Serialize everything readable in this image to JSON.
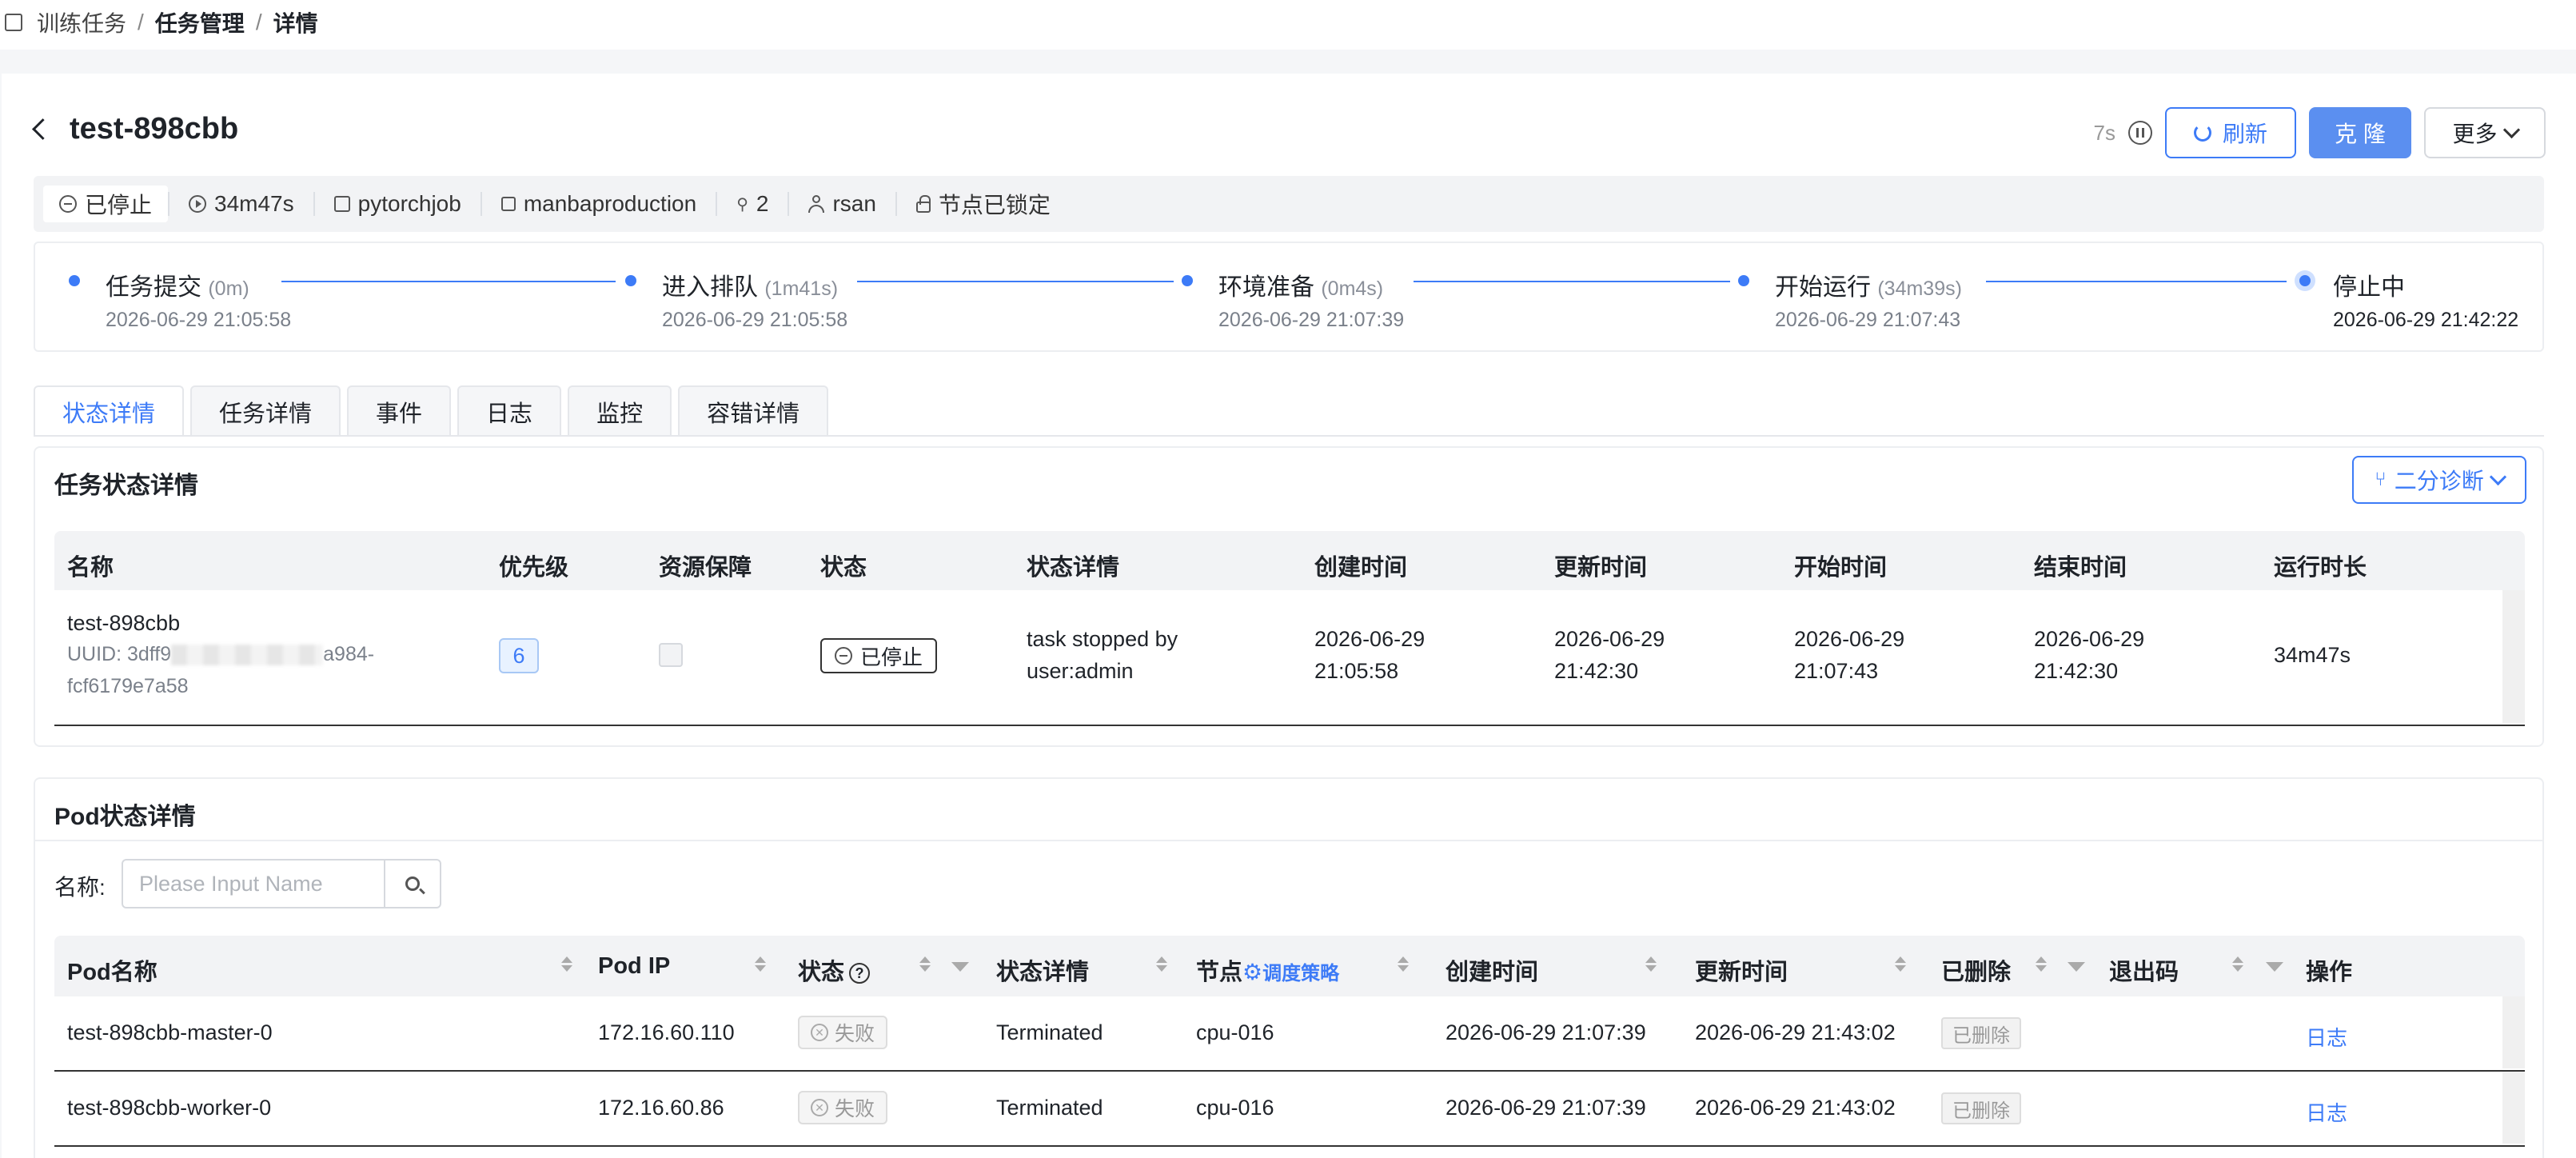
{
  "breadcrumb": {
    "items": [
      "训练任务",
      "任务管理",
      "详情"
    ],
    "separator": "/"
  },
  "header": {
    "title": "test-898cbb",
    "timer": "7s",
    "refresh_label": "刷新",
    "clone_label": "克 隆",
    "more_label": "更多"
  },
  "info": {
    "status": "已停止",
    "duration": "34m47s",
    "framework": "pytorchjob",
    "project": "manbaproduction",
    "nodes": "2",
    "user": "rsan",
    "lock": "节点已锁定"
  },
  "timeline": [
    {
      "label": "任务提交",
      "duration": "(0m)",
      "time": "2026-06-29 21:05:58"
    },
    {
      "label": "进入排队",
      "duration": "(1m41s)",
      "time": "2026-06-29 21:05:58"
    },
    {
      "label": "环境准备",
      "duration": "(0m4s)",
      "time": "2026-06-29 21:07:39"
    },
    {
      "label": "开始运行",
      "duration": "(34m39s)",
      "time": "2026-06-29 21:07:43"
    },
    {
      "label": "停止中",
      "duration": "",
      "time": "2026-06-29 21:42:22"
    }
  ],
  "tabs": [
    "状态详情",
    "任务详情",
    "事件",
    "日志",
    "监控",
    "容错详情"
  ],
  "task_status": {
    "title": "任务状态详情",
    "diagnose_label": "二分诊断",
    "columns": [
      "名称",
      "优先级",
      "资源保障",
      "状态",
      "状态详情",
      "创建时间",
      "更新时间",
      "开始时间",
      "结束时间",
      "运行时长"
    ],
    "row": {
      "name": "test-898cbb",
      "uuid_prefix": "UUID: 3dff9",
      "uuid_mid": "a984-",
      "uuid_suffix": "fcf6179e7a58",
      "priority": "6",
      "status": "已停止",
      "detail_1": "task stopped by",
      "detail_2": "user:admin",
      "created_1": "2026-06-29",
      "created_2": "21:05:58",
      "updated_1": "2026-06-29",
      "updated_2": "21:42:30",
      "started_1": "2026-06-29",
      "started_2": "21:07:43",
      "ended_1": "2026-06-29",
      "ended_2": "21:42:30",
      "runtime": "34m47s"
    }
  },
  "pod_status": {
    "title": "Pod状态详情",
    "search_label": "名称:",
    "search_placeholder": "Please Input Name",
    "columns": {
      "pod_name": "Pod名称",
      "pod_ip": "Pod IP",
      "status": "状态",
      "status_detail": "状态详情",
      "node": "节点",
      "schedule_policy": "调度策略",
      "created": "创建时间",
      "updated": "更新时间",
      "deleted": "已删除",
      "exit_code": "退出码",
      "action": "操作"
    },
    "rows": [
      {
        "name": "test-898cbb-master-0",
        "ip": "172.16.60.110",
        "status": "失败",
        "detail": "Terminated",
        "node": "cpu-016",
        "created": "2026-06-29 21:07:39",
        "updated": "2026-06-29 21:43:02",
        "deleted": "已删除",
        "exit_code": "",
        "action": "日志"
      },
      {
        "name": "test-898cbb-worker-0",
        "ip": "172.16.60.86",
        "status": "失败",
        "detail": "Terminated",
        "node": "cpu-016",
        "created": "2026-06-29 21:07:39",
        "updated": "2026-06-29 21:43:02",
        "deleted": "已删除",
        "exit_code": "",
        "action": "日志"
      }
    ]
  },
  "colors": {
    "primary": "#3d7bf7",
    "primary_fill": "#5b8ff0",
    "page_bg": "#f5f6f8"
  }
}
